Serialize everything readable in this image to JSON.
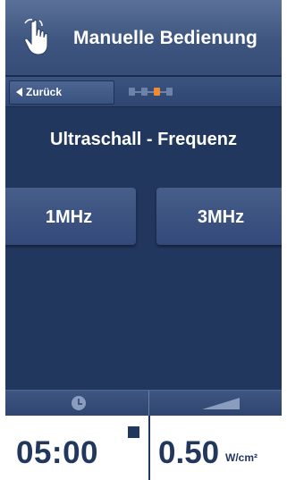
{
  "header": {
    "title": "Manuelle Bedienung",
    "icon": "hand-pointer-icon"
  },
  "nav": {
    "back_label": "Zurück",
    "progress_total": 4,
    "progress_current": 3
  },
  "subtitle": "Ultraschall - Frequenz",
  "options": [
    {
      "label": "1MHz"
    },
    {
      "label": "3MHz"
    }
  ],
  "status": {
    "timer_icon": "clock-icon",
    "intensity_icon": "ramp-icon",
    "time": "05:00",
    "intensity_value": "0.50",
    "intensity_unit": "W/cm²"
  },
  "colors": {
    "background": "#22375e",
    "header": "#4a6390",
    "accent": "#f08a2c",
    "readout_text": "#22375e"
  }
}
